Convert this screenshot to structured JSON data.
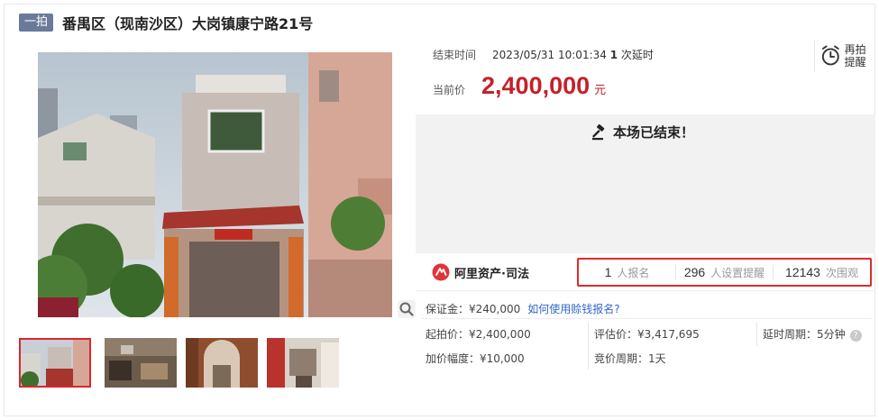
{
  "header": {
    "badge": "一拍",
    "title": "番禺区（现南沙区）大岗镇康宁路21号"
  },
  "auction": {
    "end_label": "结束时间",
    "end_time": "2023/05/31 10:01:34",
    "delay_count": "1",
    "delay_label": "次延时",
    "price_label": "当前价",
    "price": "2,400,000",
    "price_unit": "元",
    "remind_label": "再拍提醒",
    "ended_text": "本场已结束！"
  },
  "platform": {
    "name": "阿里资产·司法"
  },
  "stats": [
    {
      "num": "1",
      "label": "人报名"
    },
    {
      "num": "296",
      "label": "人设置提醒"
    },
    {
      "num": "12143",
      "label": "次围观"
    }
  ],
  "deposit": {
    "text": "保证金：¥240,000",
    "link": "如何使用赊钱报名?"
  },
  "details": {
    "start_price": "起拍价：¥2,400,000",
    "appraisal": "评估价：¥3,417,695",
    "delay_period": "延时周期：5分钟",
    "increment": "加价幅度：¥10,000",
    "bid_period": "竞价周期：1天"
  },
  "colors": {
    "accent": "#c3212b",
    "badge": "#6b7a99",
    "highlight_border": "#e02a2a"
  },
  "icons": {
    "alarm": "alarm-clock-icon",
    "gavel": "gavel-icon",
    "zoom": "magnifier-icon",
    "help": "question-icon"
  }
}
